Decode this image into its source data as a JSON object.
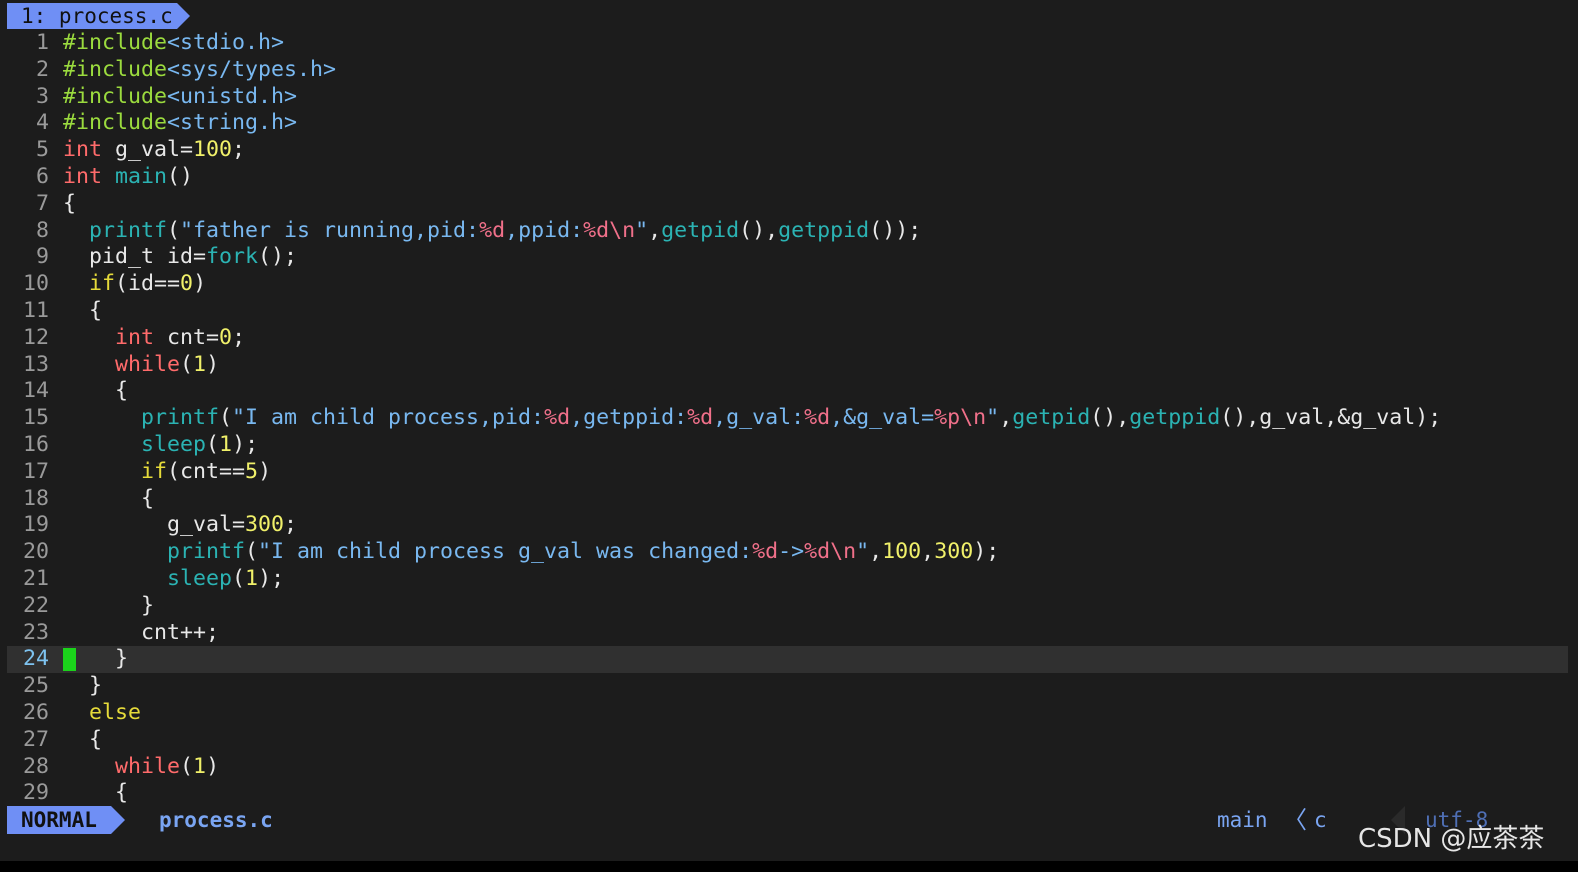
{
  "tab": {
    "label": "1: process.c"
  },
  "colors": {
    "plain": "#e8e8e8",
    "keyword": "#ff6b6b",
    "control": "#e6db3a",
    "number": "#f0f06a",
    "function": "#2bb3b3",
    "string": "#79b8f0",
    "format": "#f0708a",
    "preproc": "#9bdb3e",
    "header": "#79b8f0",
    "cursor": "#1bd31b",
    "accent": "#6f8ff5"
  },
  "code": {
    "lines": [
      {
        "n": "1",
        "tokens": [
          [
            "#include",
            "preproc"
          ],
          [
            "<stdio.h>",
            "header"
          ]
        ]
      },
      {
        "n": "2",
        "tokens": [
          [
            "#include",
            "preproc"
          ],
          [
            "<sys/types.h>",
            "header"
          ]
        ]
      },
      {
        "n": "3",
        "tokens": [
          [
            "#include",
            "preproc"
          ],
          [
            "<unistd.h>",
            "header"
          ]
        ]
      },
      {
        "n": "4",
        "tokens": [
          [
            "#include",
            "preproc"
          ],
          [
            "<string.h>",
            "header"
          ]
        ]
      },
      {
        "n": "5",
        "tokens": [
          [
            "int",
            "keyword"
          ],
          [
            " g_val=",
            "plain"
          ],
          [
            "100",
            "number"
          ],
          [
            ";",
            "plain"
          ]
        ]
      },
      {
        "n": "6",
        "tokens": [
          [
            "int",
            "keyword"
          ],
          [
            " ",
            "plain"
          ],
          [
            "main",
            "function"
          ],
          [
            "()",
            "plain"
          ]
        ]
      },
      {
        "n": "7",
        "tokens": [
          [
            "{",
            "plain"
          ]
        ]
      },
      {
        "n": "8",
        "tokens": [
          [
            "  ",
            "plain"
          ],
          [
            "printf",
            "function"
          ],
          [
            "(",
            "plain"
          ],
          [
            "\"father is running,pid:",
            "string"
          ],
          [
            "%d",
            "format"
          ],
          [
            "string_sep",
            "skip"
          ],
          [
            ",ppid:",
            "string"
          ],
          [
            "%d\\n",
            "format"
          ],
          [
            "\"",
            "string"
          ],
          [
            ",",
            "plain"
          ],
          [
            "getpid",
            "function"
          ],
          [
            "(),",
            "plain"
          ],
          [
            "getppid",
            "function"
          ],
          [
            "());",
            "plain"
          ]
        ]
      },
      {
        "n": "9",
        "tokens": [
          [
            "  pid_t id=",
            "plain"
          ],
          [
            "fork",
            "function"
          ],
          [
            "();",
            "plain"
          ]
        ]
      },
      {
        "n": "10",
        "tokens": [
          [
            "  ",
            "plain"
          ],
          [
            "if",
            "control"
          ],
          [
            "(id==",
            "plain"
          ],
          [
            "0",
            "number"
          ],
          [
            ")",
            "plain"
          ]
        ]
      },
      {
        "n": "11",
        "tokens": [
          [
            "  {",
            "plain"
          ]
        ]
      },
      {
        "n": "12",
        "tokens": [
          [
            "    ",
            "plain"
          ],
          [
            "int",
            "keyword"
          ],
          [
            " cnt=",
            "plain"
          ],
          [
            "0",
            "number"
          ],
          [
            ";",
            "plain"
          ]
        ]
      },
      {
        "n": "13",
        "tokens": [
          [
            "    ",
            "plain"
          ],
          [
            "while",
            "keyword"
          ],
          [
            "(",
            "plain"
          ],
          [
            "1",
            "number"
          ],
          [
            ")",
            "plain"
          ]
        ]
      },
      {
        "n": "14",
        "tokens": [
          [
            "    {",
            "plain"
          ]
        ]
      },
      {
        "n": "15",
        "tokens": [
          [
            "      ",
            "plain"
          ],
          [
            "printf",
            "function"
          ],
          [
            "(",
            "plain"
          ],
          [
            "\"I am child process,pid:",
            "string"
          ],
          [
            "%d",
            "format"
          ],
          [
            ",getppid:",
            "string"
          ],
          [
            "%d",
            "format"
          ],
          [
            ",g_val:",
            "string"
          ],
          [
            "%d",
            "format"
          ],
          [
            ",&g_val=",
            "string"
          ],
          [
            "%p\\n",
            "format"
          ],
          [
            "\"",
            "string"
          ],
          [
            ",",
            "plain"
          ],
          [
            "getpid",
            "function"
          ],
          [
            "(),",
            "plain"
          ],
          [
            "getppid",
            "function"
          ],
          [
            "(),g_val,&g_val);",
            "plain"
          ]
        ]
      },
      {
        "n": "16",
        "tokens": [
          [
            "      ",
            "plain"
          ],
          [
            "sleep",
            "function"
          ],
          [
            "(",
            "plain"
          ],
          [
            "1",
            "number"
          ],
          [
            ");",
            "plain"
          ]
        ]
      },
      {
        "n": "17",
        "tokens": [
          [
            "      ",
            "plain"
          ],
          [
            "if",
            "control"
          ],
          [
            "(cnt==",
            "plain"
          ],
          [
            "5",
            "number"
          ],
          [
            ")",
            "plain"
          ]
        ]
      },
      {
        "n": "18",
        "tokens": [
          [
            "      {",
            "plain"
          ]
        ]
      },
      {
        "n": "19",
        "tokens": [
          [
            "        g_val=",
            "plain"
          ],
          [
            "300",
            "number"
          ],
          [
            ";",
            "plain"
          ]
        ]
      },
      {
        "n": "20",
        "tokens": [
          [
            "        ",
            "plain"
          ],
          [
            "printf",
            "function"
          ],
          [
            "(",
            "plain"
          ],
          [
            "\"I am child process g_val was changed:",
            "string"
          ],
          [
            "%d",
            "format"
          ],
          [
            "->",
            "string"
          ],
          [
            "%d\\n",
            "format"
          ],
          [
            "\"",
            "string"
          ],
          [
            ",",
            "plain"
          ],
          [
            "100",
            "number"
          ],
          [
            ",",
            "plain"
          ],
          [
            "300",
            "number"
          ],
          [
            ");",
            "plain"
          ]
        ]
      },
      {
        "n": "21",
        "tokens": [
          [
            "        ",
            "plain"
          ],
          [
            "sleep",
            "function"
          ],
          [
            "(",
            "plain"
          ],
          [
            "1",
            "number"
          ],
          [
            ");",
            "plain"
          ]
        ]
      },
      {
        "n": "22",
        "tokens": [
          [
            "      }",
            "plain"
          ]
        ]
      },
      {
        "n": "23",
        "tokens": [
          [
            "      cnt++;",
            "plain"
          ]
        ]
      },
      {
        "n": "24",
        "tokens": [
          [
            "    }",
            "plain"
          ]
        ],
        "current": true
      },
      {
        "n": "25",
        "tokens": [
          [
            "  }",
            "plain"
          ]
        ]
      },
      {
        "n": "26",
        "tokens": [
          [
            "  ",
            "plain"
          ],
          [
            "else",
            "control"
          ]
        ]
      },
      {
        "n": "27",
        "tokens": [
          [
            "  {",
            "plain"
          ]
        ]
      },
      {
        "n": "28",
        "tokens": [
          [
            "    ",
            "plain"
          ],
          [
            "while",
            "keyword"
          ],
          [
            "(",
            "plain"
          ],
          [
            "1",
            "number"
          ],
          [
            ")",
            "plain"
          ]
        ]
      },
      {
        "n": "29",
        "tokens": [
          [
            "    {",
            "plain"
          ]
        ]
      }
    ]
  },
  "statusline": {
    "mode": "NORMAL",
    "filename": "process.c",
    "function": "main",
    "separator": "〈",
    "filetype": "c",
    "encoding": "utf-8"
  },
  "watermark": "CSDN @应茶茶"
}
